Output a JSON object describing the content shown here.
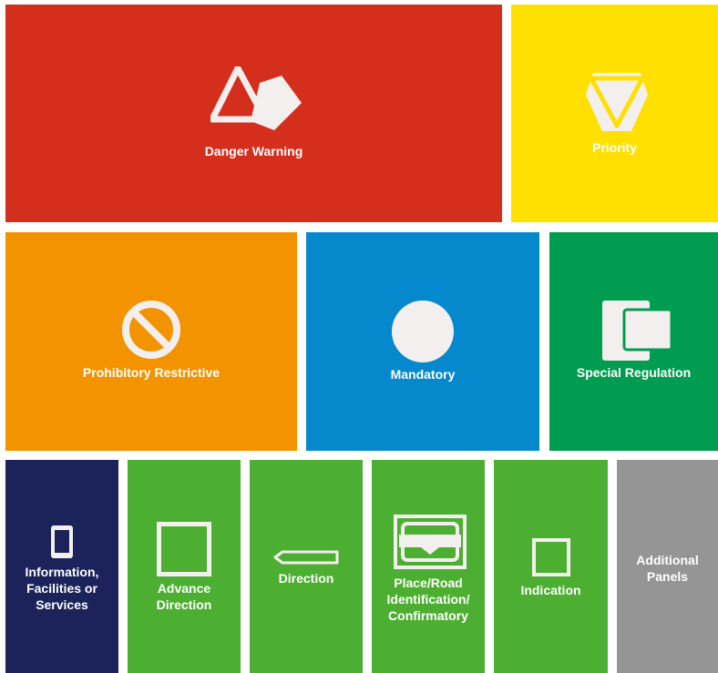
{
  "colors": {
    "danger": "#d42e1c",
    "priority": "#ffe000",
    "prohibitory": "#f39300",
    "mandatory": "#0688cd",
    "special": "#009c50",
    "information": "#1b235a",
    "green": "#4daf31",
    "additional": "#959595",
    "icon_fill": "#f4efef"
  },
  "categories": [
    {
      "key": "danger",
      "label": "Danger Warning",
      "icon": "warning-triangle-icon"
    },
    {
      "key": "priority",
      "label": "Priority",
      "icon": "yield-sign-icon"
    },
    {
      "key": "prohibitory",
      "label": "Prohibitory Restrictive",
      "icon": "prohibition-circle-icon"
    },
    {
      "key": "mandatory",
      "label": "Mandatory",
      "icon": "filled-circle-icon"
    },
    {
      "key": "special",
      "label": "Special Regulation",
      "icon": "overlapping-squares-icon"
    },
    {
      "key": "information",
      "label": "Information,\nFacilities or\nServices",
      "icon": "phone-rectangle-icon"
    },
    {
      "key": "advance",
      "label": "Advance\nDirection",
      "icon": "square-outline-icon"
    },
    {
      "key": "direction",
      "label": "Direction",
      "icon": "direction-arrow-icon"
    },
    {
      "key": "place",
      "label": "Place/Road\nIdentification/\nConfirmatory",
      "icon": "place-sign-icon"
    },
    {
      "key": "indication",
      "label": "Indication",
      "icon": "small-square-icon"
    },
    {
      "key": "additional",
      "label": "Additional\nPanels",
      "icon": ""
    }
  ]
}
